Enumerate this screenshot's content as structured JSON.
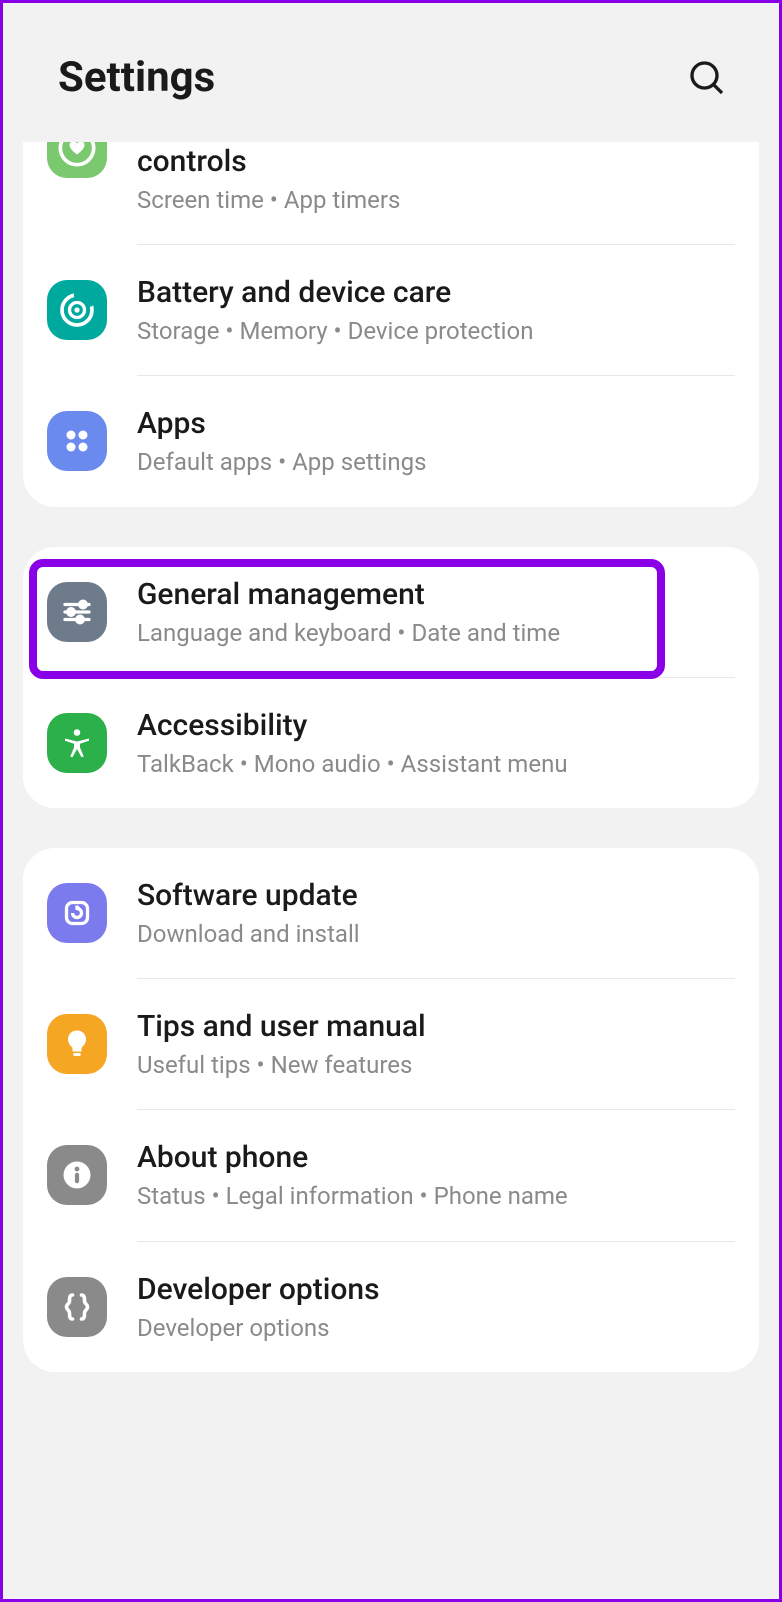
{
  "header": {
    "title": "Settings"
  },
  "groups": [
    {
      "items": [
        {
          "id": "digital-wellbeing",
          "title": "controls",
          "subtitle": "Screen time  •  App timers",
          "iconBg": "bg-green1",
          "icon": "heart-circle",
          "partial": true
        },
        {
          "id": "battery-device-care",
          "title": "Battery and device care",
          "subtitle": "Storage  •  Memory  •  Device protection",
          "iconBg": "bg-teal",
          "icon": "target"
        },
        {
          "id": "apps",
          "title": "Apps",
          "subtitle": "Default apps  •  App settings",
          "iconBg": "bg-blue",
          "icon": "grid4"
        }
      ]
    },
    {
      "items": [
        {
          "id": "general-management",
          "title": "General management",
          "subtitle": "Language and keyboard  •  Date and time",
          "iconBg": "bg-slategray",
          "icon": "sliders",
          "highlighted": true
        },
        {
          "id": "accessibility",
          "title": "Accessibility",
          "subtitle": "TalkBack  •  Mono audio  •  Assistant menu",
          "iconBg": "bg-green2",
          "icon": "person"
        }
      ]
    },
    {
      "items": [
        {
          "id": "software-update",
          "title": "Software update",
          "subtitle": "Download and install",
          "iconBg": "bg-violet",
          "icon": "refresh-square"
        },
        {
          "id": "tips-manual",
          "title": "Tips and user manual",
          "subtitle": "Useful tips  •  New features",
          "iconBg": "bg-orange",
          "icon": "bulb"
        },
        {
          "id": "about-phone",
          "title": "About phone",
          "subtitle": "Status  •  Legal information  •  Phone name",
          "iconBg": "bg-gray",
          "icon": "info"
        },
        {
          "id": "developer-options",
          "title": "Developer options",
          "subtitle": "Developer options",
          "iconBg": "bg-gray",
          "icon": "braces"
        }
      ]
    }
  ]
}
